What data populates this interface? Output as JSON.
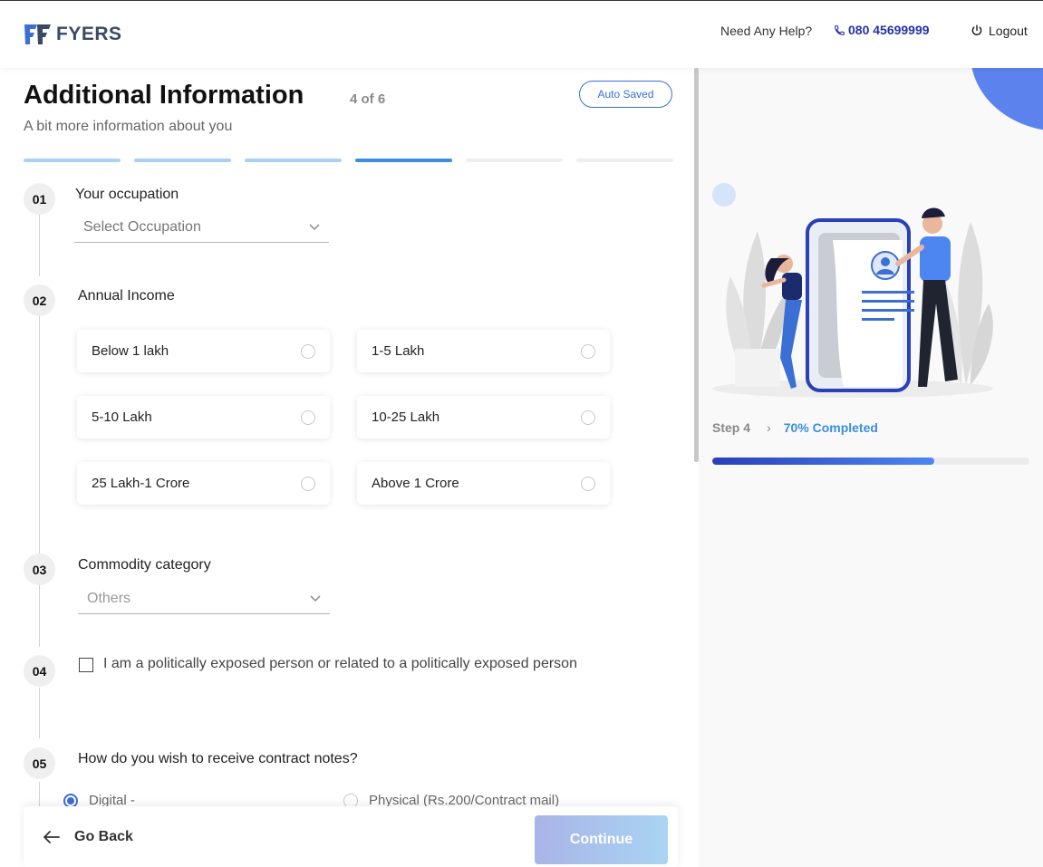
{
  "header": {
    "brand": "FYERS",
    "help_text": "Need Any Help?",
    "phone": "080 45699999",
    "logout_label": "Logout"
  },
  "form": {
    "title": "Additional Information",
    "step_count": "4 of 6",
    "autosaved_label": "Auto Saved",
    "subtitle": "A bit more information about you",
    "progress_segments": [
      {
        "state": "done",
        "color": "#a9d0f5"
      },
      {
        "state": "done",
        "color": "#a9d0f5"
      },
      {
        "state": "done",
        "color": "#a9d0f5"
      },
      {
        "state": "current",
        "color": "#3b8ee0"
      },
      {
        "state": "todo",
        "color": "#eeeeee"
      },
      {
        "state": "todo",
        "color": "#eeeeee"
      }
    ],
    "steps": {
      "s1": {
        "num": "01",
        "label": "Your occupation",
        "placeholder": "Select Occupation"
      },
      "s2": {
        "num": "02",
        "label": "Annual Income",
        "options": [
          "Below 1 lakh",
          "1-5 Lakh",
          "5-10 Lakh",
          "10-25 Lakh",
          "25 Lakh-1 Crore",
          "Above 1 Crore"
        ]
      },
      "s3": {
        "num": "03",
        "label": "Commodity category",
        "value": "Others"
      },
      "s4": {
        "num": "04",
        "label": "I am a politically exposed person or related to a politically exposed person",
        "checked": false
      },
      "s5": {
        "num": "05",
        "label": "How do you wish to receive contract notes?",
        "options": [
          {
            "label": "Digital -",
            "selected": true
          },
          {
            "label": "Physical (Rs.200/Contract mail)",
            "selected": false
          }
        ]
      }
    },
    "go_back_label": "Go Back",
    "continue_label": "Continue"
  },
  "sidebar": {
    "step_label": "Step 4",
    "completed_label": "70% Completed",
    "progress": 0.7
  },
  "colors": {
    "accent": "#3b6fd4",
    "brand": "#2a3fb8"
  },
  "icons": {
    "phone": "phone-icon",
    "logout": "power-icon",
    "chevron": "chevron-down-icon",
    "back": "arrow-left-icon"
  }
}
